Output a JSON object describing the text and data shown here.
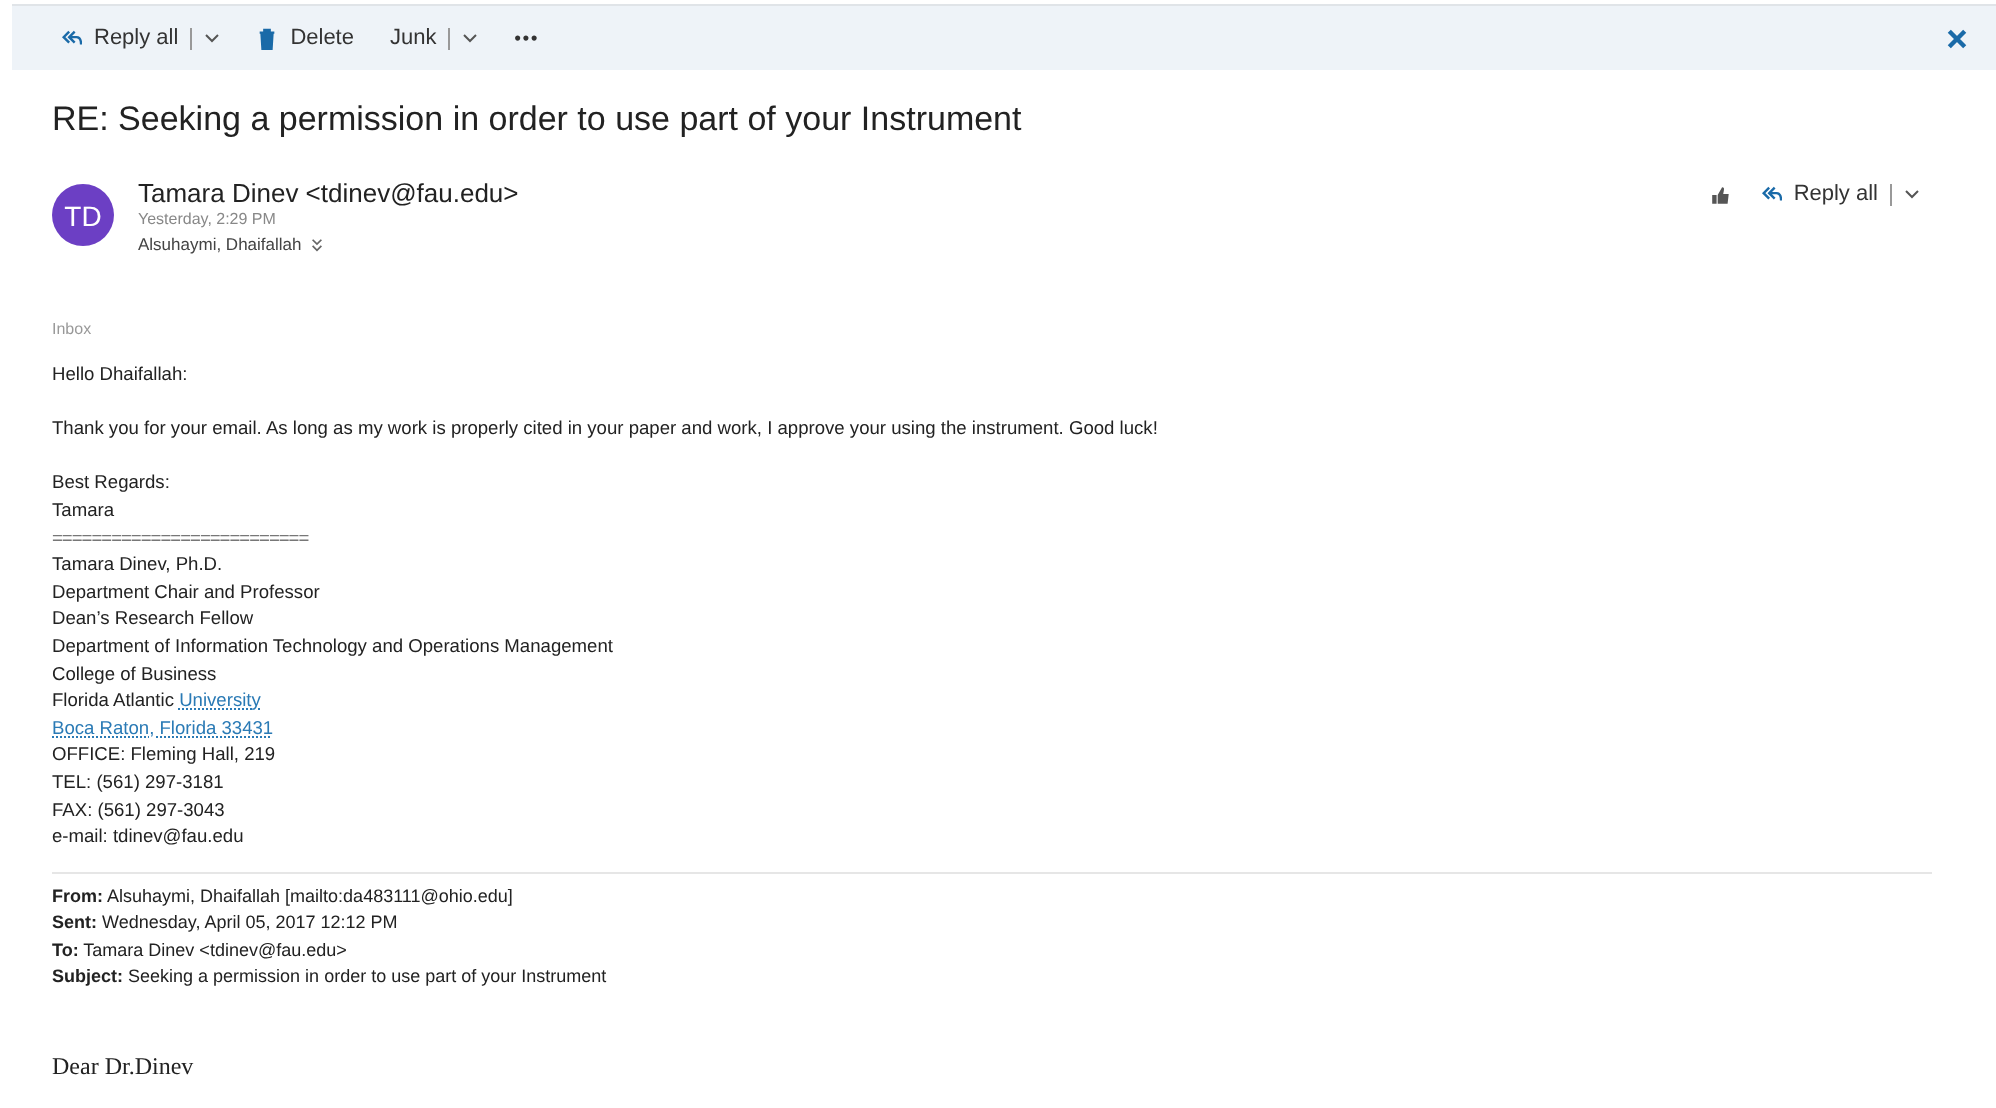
{
  "toolbar": {
    "buttons": [
      {
        "kind": "reply",
        "label": "Reply all"
      },
      {
        "kind": "delete",
        "label": "Delete"
      },
      {
        "kind": "junk",
        "label": "Junk"
      },
      {
        "kind": "more",
        "label": "•••"
      }
    ]
  },
  "subject": "RE: Seeking a permission in order to use part of your Instrument",
  "message": {
    "avatar": "TD",
    "sender": "Tamara Dinev <tdinev@fau.edu>",
    "time": "Yesterday, 2:29 PM",
    "recipient": "Alsuhaymi, Dhaifallah",
    "reply_button": "Reply all"
  },
  "folder": "Inbox",
  "body": [
    {
      "kind": "text",
      "text": "Hello Dhaifallah:"
    },
    {
      "kind": "gap"
    },
    {
      "kind": "text",
      "text": "Thank you for your email. As long as my work is properly cited in your paper and work, I approve your using the instrument. Good luck!"
    },
    {
      "kind": "gap"
    },
    {
      "kind": "text",
      "text": "Best Regards:"
    },
    {
      "kind": "text",
      "text": "Tamara"
    },
    {
      "kind": "rule",
      "text": "=========================="
    },
    {
      "kind": "text",
      "text": "Tamara Dinev, Ph.D."
    },
    {
      "kind": "text",
      "text": "Department Chair and Professor"
    },
    {
      "kind": "text",
      "text": "Dean’s Research Fellow"
    },
    {
      "kind": "text",
      "text": "Department of Information Technology and Operations Management"
    },
    {
      "kind": "text",
      "text": "College of Business"
    },
    {
      "kind": "mixed",
      "text": "Florida Atlantic",
      "link": "University"
    },
    {
      "kind": "link",
      "text": "Boca Raton, Florida 33431"
    },
    {
      "kind": "text",
      "text": "OFFICE: Fleming Hall, 219"
    },
    {
      "kind": "text",
      "text": "TEL: (561) 297-3181"
    },
    {
      "kind": "text",
      "text": "FAX: (561) 297-3043"
    },
    {
      "kind": "text",
      "text": "e-mail: tdinev@fau.edu"
    }
  ],
  "quoted_header": [
    "**From:** Alsuhaymi, Dhaifallah [mailto:da483111@ohio.edu]",
    "**Sent:** Wednesday, April 05, 2017 12:12 PM",
    "**To:** Tamara Dinev <tdinev@fau.edu>",
    "**Subject:** Seeking a permission in order to use part of your Instrument"
  ],
  "quoted_body": "Dear Dr.Dinev"
}
